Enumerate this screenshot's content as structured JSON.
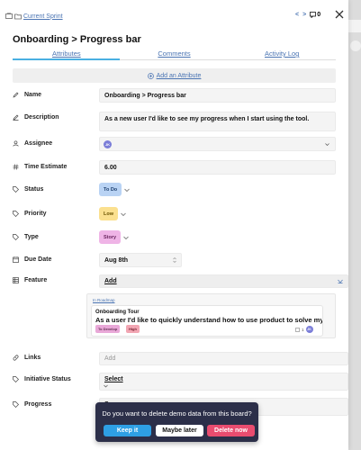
{
  "breadcrumb": {
    "label": "Current Sprint"
  },
  "nav": {
    "prev": "<",
    "next": ">",
    "count": "0"
  },
  "card": {
    "title": "Onboarding > Progress bar"
  },
  "tabs": [
    {
      "label": "Attributes"
    },
    {
      "label": "Comments"
    },
    {
      "label": "Activity Log"
    }
  ],
  "add_attribute": {
    "label": "Add an Attribute"
  },
  "fields": {
    "name": {
      "label": "Name",
      "value": "Onboarding > Progress bar"
    },
    "description": {
      "label": "Description",
      "value": "As a new user I'd like to see my progress when I start using the tool."
    },
    "assignee": {
      "label": "Assignee",
      "avatar": "JK"
    },
    "time_estimate": {
      "label": "Time Estimate",
      "value": "6.00"
    },
    "status": {
      "label": "Status",
      "value": "To Do",
      "color": "#b9d3f4"
    },
    "priority": {
      "label": "Priority",
      "value": "Low",
      "color": "#fbe08f"
    },
    "type": {
      "label": "Type",
      "value": "Story",
      "color": "#efb4e6"
    },
    "due_date": {
      "label": "Due Date",
      "value": "Aug 8th"
    },
    "feature": {
      "label": "Feature",
      "value": "Add"
    },
    "links": {
      "label": "Links",
      "placeholder": "Add"
    },
    "initiative_status": {
      "label": "Initiative Status",
      "value": "Select"
    },
    "progress": {
      "label": "Progress",
      "value": "Se"
    }
  },
  "feature_card": {
    "roadmap_link": "In Roadmap",
    "title": "Onboarding Tour",
    "description": "As a user I'd like to quickly understand how to use product to solve my prol",
    "tags": [
      "To Develop",
      "High"
    ],
    "count": "1",
    "avatar": "JK"
  },
  "toast": {
    "message": "Do you want to delete demo data from this board?",
    "keep": "Keep it",
    "maybe": "Maybe later",
    "delete": "Delete now"
  },
  "colors": {
    "accent": "#4a74b3",
    "tab_active": "#4ab0e2",
    "toast_bg": "#2c2f49",
    "keep_btn": "#2e9fe4",
    "delete_btn": "#e94c6f"
  }
}
